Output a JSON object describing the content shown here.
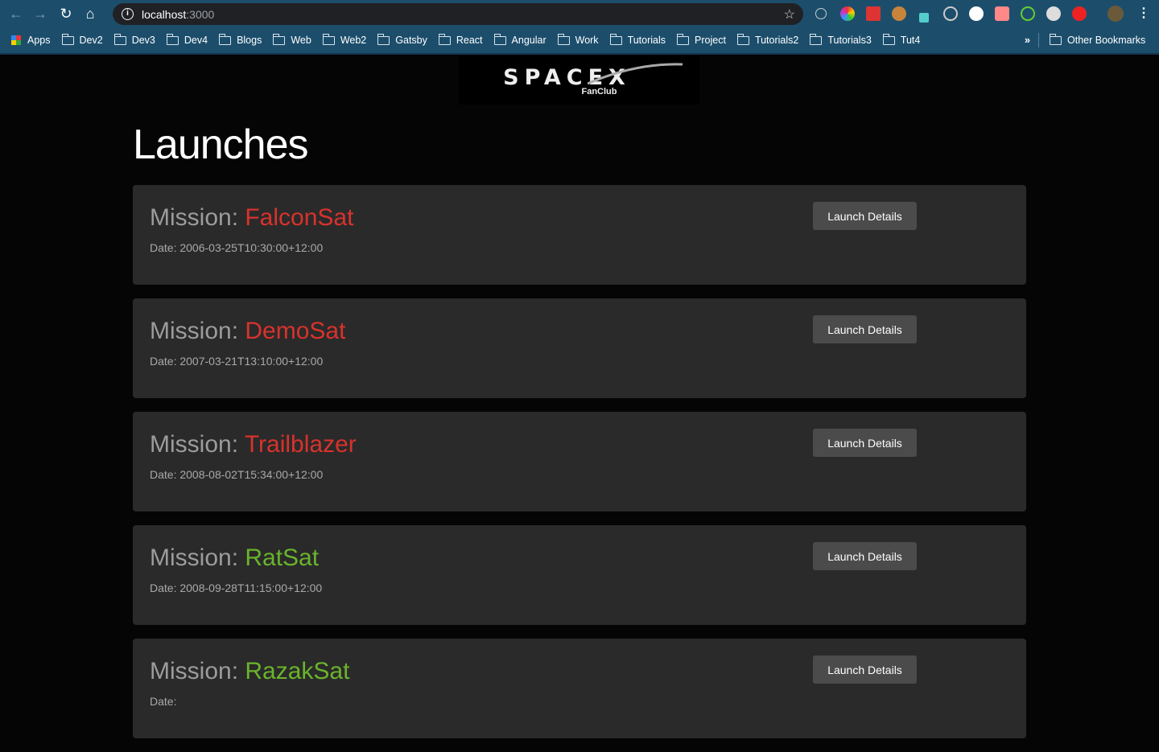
{
  "browser": {
    "url_host": "localhost",
    "url_port": ":3000",
    "bookmarks": [
      "Apps",
      "Dev2",
      "Dev3",
      "Dev4",
      "Blogs",
      "Web",
      "Web2",
      "Gatsby",
      "React",
      "Angular",
      "Work",
      "Tutorials",
      "Project",
      "Tutorials2",
      "Tutorials3",
      "Tut4"
    ],
    "overflow": "»",
    "other_bookmarks": "Other Bookmarks"
  },
  "logo": {
    "text": "SPACEX",
    "sub": "FanClub"
  },
  "page": {
    "title": "Launches",
    "mission_prefix": "Mission: ",
    "date_prefix": "Date: ",
    "button_label": "Launch Details"
  },
  "colors": {
    "failed": "#d9322c",
    "success": "#6ab42b"
  },
  "launches": [
    {
      "name": "FalconSat",
      "date": "2006-03-25T10:30:00+12:00",
      "success": false
    },
    {
      "name": "DemoSat",
      "date": "2007-03-21T13:10:00+12:00",
      "success": false
    },
    {
      "name": "Trailblazer",
      "date": "2008-08-02T15:34:00+12:00",
      "success": false
    },
    {
      "name": "RatSat",
      "date": "2008-09-28T11:15:00+12:00",
      "success": true
    },
    {
      "name": "RazakSat",
      "date": "",
      "success": true
    }
  ]
}
